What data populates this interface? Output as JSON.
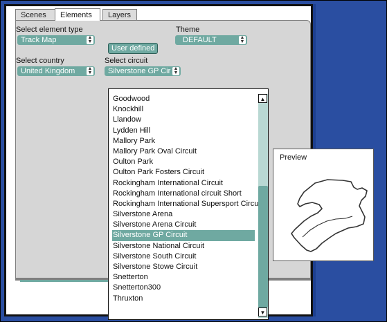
{
  "tabs": [
    "Scenes",
    "Elements",
    "Layers"
  ],
  "active_tab": "Elements",
  "element_type": {
    "label": "Select element type",
    "value": "Track Map"
  },
  "user_defined_button": "User defined",
  "theme": {
    "label": "Theme",
    "value": "DEFAULT"
  },
  "country": {
    "label": "Select country",
    "value": "United Kingdom"
  },
  "circuit": {
    "label": "Select circuit",
    "value": "Silverstone GP Cir"
  },
  "circuit_options": [
    "Goodwood",
    "Knockhill",
    "Llandow",
    "Lydden Hill",
    "Mallory Park",
    "Mallory Park Oval Circuit",
    "Oulton Park",
    "Oulton Park Fosters Circuit",
    "Rockingham International Circuit",
    "Rockingham International circuit Short",
    "Rockingham International Supersport Circuit",
    "Silverstone Arena",
    "Silverstone Arena Circuit",
    "Silverstone GP Circuit",
    "Silverstone National Circuit",
    "Silverstone South Circuit",
    "Silverstone Stowe Circuit",
    "Snetterton",
    "Snetterton300",
    "Thruxton"
  ],
  "selected_circuit": "Silverstone GP Circuit",
  "preview_label": "Preview",
  "colors": {
    "accent": "#6fa9a1",
    "window_background": "#2a4ea1",
    "panel": "#d6d6d6"
  }
}
